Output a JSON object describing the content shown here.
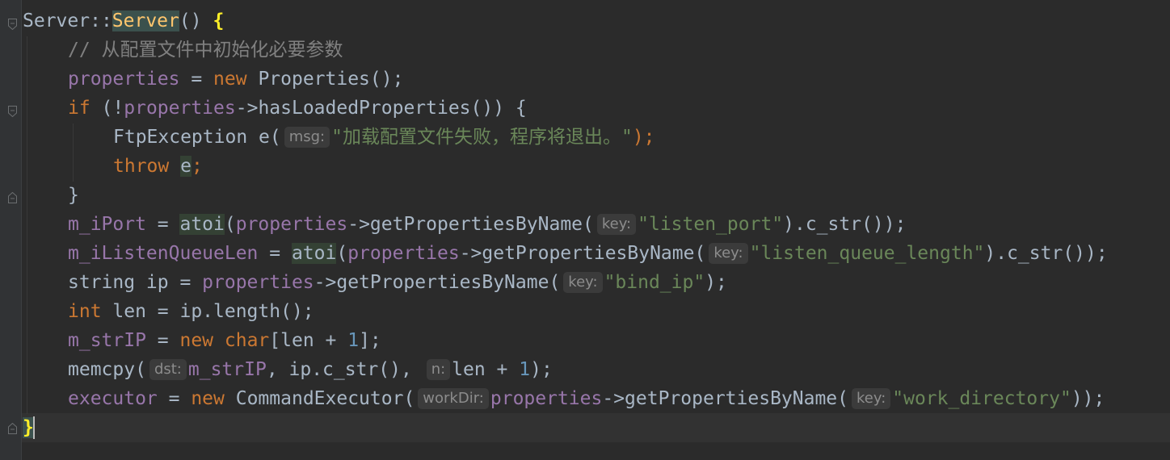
{
  "code": {
    "l1": {
      "cls": "Server",
      "sep": "::",
      "ctor": "Server",
      "paren": "() ",
      "brace": "{"
    },
    "l2": {
      "comment": "// 从配置文件中初始化必要参数"
    },
    "l3": {
      "field": "properties",
      "eq": " = ",
      "kw_new": "new",
      "sp": " ",
      "type": "Properties",
      "rest": "();"
    },
    "l4": {
      "kw_if": "if",
      "p1": " (!",
      "field": "properties",
      "arrow": "->",
      "call": "hasLoadedProperties()) {"
    },
    "l5": {
      "type": "FtpException e(",
      "hint": "msg:",
      "str": "\"加载配置文件失败，程序将退出。\"",
      "end": ");"
    },
    "l6": {
      "kw_throw": "throw",
      "sp": " ",
      "var": "e",
      "end": ";"
    },
    "l7": {
      "brace": "}"
    },
    "l8": {
      "field": "m_iPort",
      "eq": " = ",
      "fn": "atoi",
      "p": "(",
      "field2": "properties",
      "call": "->getPropertiesByName(",
      "hint": "key:",
      "str": "\"listen_port\"",
      "end": ").c_str());"
    },
    "l9": {
      "field": "m_iListenQueueLen",
      "eq": " = ",
      "fn": "atoi",
      "p": "(",
      "field2": "properties",
      "call": "->getPropertiesByName(",
      "hint": "key:",
      "str": "\"listen_queue_length\"",
      "end": ").c_str());"
    },
    "l10": {
      "pre": "string ip = ",
      "field": "properties",
      "call": "->getPropertiesByName(",
      "hint": "key:",
      "str": "\"bind_ip\"",
      "end": ");"
    },
    "l11": {
      "kw_int": "int",
      "rest": " len = ip.length();"
    },
    "l12": {
      "field": "m_strIP",
      "eq": " = ",
      "kw_new": "new",
      "sp": " ",
      "kw_char": "char",
      "p": "[len + ",
      "num": "1",
      "end": "];"
    },
    "l13": {
      "call": "memcpy(",
      "hint1": "dst:",
      "field": "m_strIP",
      "mid": ", ip.c_str(), ",
      "hint2": "n:",
      "rest": "len + ",
      "num": "1",
      "end": ");"
    },
    "l14": {
      "field": "executor",
      "eq": " = ",
      "kw_new": "new",
      "sp": " ",
      "type": "CommandExecutor(",
      "hint1": "workDir:",
      "field2": "properties",
      "call": "->getPropertiesByName(",
      "hint2": "key:",
      "str": "\"work_directory\"",
      "end": "));"
    },
    "l15": {
      "brace": "}"
    }
  },
  "colors": {
    "background": "#2b2b2b",
    "keyword": "#cc7832",
    "field": "#9876aa",
    "string": "#6a8759",
    "number": "#6897bb",
    "comment": "#808080",
    "function": "#ffc66d",
    "text": "#a9b7c6"
  }
}
